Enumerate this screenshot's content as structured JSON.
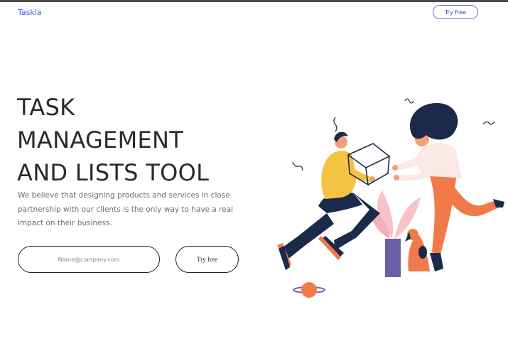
{
  "header": {
    "logo_text": "Taskia",
    "cta_label": "Try free"
  },
  "hero": {
    "title_lines": [
      "TASK",
      "MANAGEMENT",
      "AND LISTS TOOL"
    ],
    "description": "We believe that designing products and services in close partnership with our clients is the only way to have a real impact on their business.",
    "email_placeholder": "Name@company.com",
    "email_value": "",
    "cta_label": "Try free"
  },
  "illustration": {
    "icon": "people-carrying-box-illustration"
  },
  "colors": {
    "brand": "#3c5bd6",
    "text": "#2a2a2a",
    "muted": "#6d6d6d",
    "shirt_yellow": "#f6c443",
    "navy": "#1b2a4a",
    "orange": "#f07a4a",
    "purple": "#6c5fa6",
    "pink": "#f7c3c8"
  }
}
